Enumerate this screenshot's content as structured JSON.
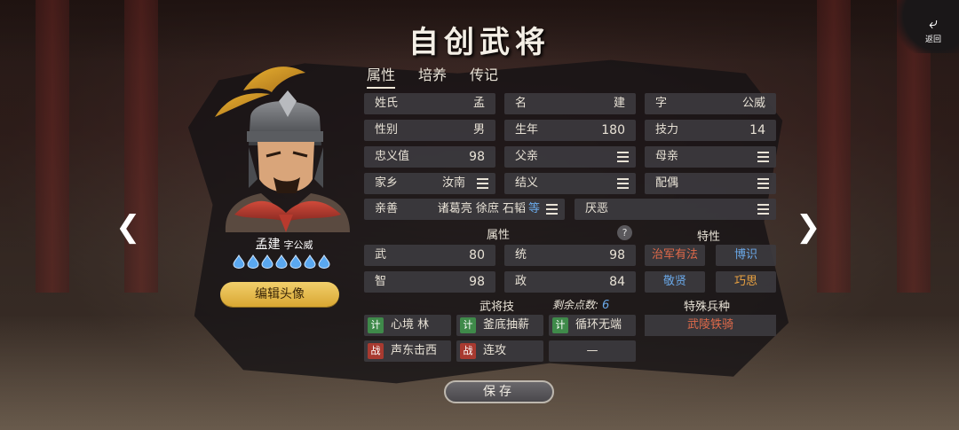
{
  "title": "自创武将",
  "back": {
    "label": "返回"
  },
  "tabs": [
    {
      "label": "属性",
      "active": true
    },
    {
      "label": "培养",
      "active": false
    },
    {
      "label": "传记",
      "active": false
    }
  ],
  "hero": {
    "name": "孟建",
    "courtesy": "字公威",
    "star_count": 7,
    "edit_avatar_label": "编辑头像"
  },
  "info": {
    "surname": {
      "label": "姓氏",
      "value": "孟"
    },
    "given_name": {
      "label": "名",
      "value": "建"
    },
    "courtesy": {
      "label": "字",
      "value": "公威"
    },
    "gender": {
      "label": "性别",
      "value": "男"
    },
    "birth_year": {
      "label": "生年",
      "value": "180"
    },
    "skill_power": {
      "label": "技力",
      "value": "14"
    },
    "loyalty": {
      "label": "忠义值",
      "value": "98"
    },
    "father": {
      "label": "父亲"
    },
    "mother": {
      "label": "母亲"
    },
    "hometown": {
      "label": "家乡",
      "value": "汝南"
    },
    "sworn": {
      "label": "结义"
    },
    "spouse": {
      "label": "配偶"
    },
    "likes": {
      "label": "亲善",
      "value": "诸葛亮 徐庶 石韬",
      "more": "等"
    },
    "dislikes": {
      "label": "厌恶"
    }
  },
  "attributes": {
    "heading": "属性",
    "help": "?",
    "wu": {
      "label": "武",
      "value": "80"
    },
    "tong": {
      "label": "统",
      "value": "98"
    },
    "zhi": {
      "label": "智",
      "value": "98"
    },
    "zheng": {
      "label": "政",
      "value": "84"
    }
  },
  "traits": {
    "heading": "特性",
    "items": [
      {
        "label": "治军有法",
        "color": "#e06a4a"
      },
      {
        "label": "博识",
        "color": "#6aa8e8"
      },
      {
        "label": "敬贤",
        "color": "#6aa8e8"
      },
      {
        "label": "巧思",
        "color": "#e8a040"
      }
    ]
  },
  "skills": {
    "heading": "武将技",
    "remaining_label": "剩余点数:",
    "remaining_value": "6",
    "items": [
      {
        "tag": "计",
        "name": "心境 林"
      },
      {
        "tag": "计",
        "name": "釜底抽薪"
      },
      {
        "tag": "计",
        "name": "循环无端"
      },
      {
        "tag": "战",
        "name": "声东击西"
      },
      {
        "tag": "战",
        "name": "连攻"
      },
      {
        "tag": "",
        "name": "—"
      }
    ]
  },
  "special_troop": {
    "heading": "特殊兵种",
    "value": "武陵铁骑"
  },
  "save_label": "保存",
  "colors": {
    "gold": "#e0b040",
    "panel": "#3c3a3e",
    "ji": "#3f8a4a",
    "zhan": "#a83a30"
  }
}
